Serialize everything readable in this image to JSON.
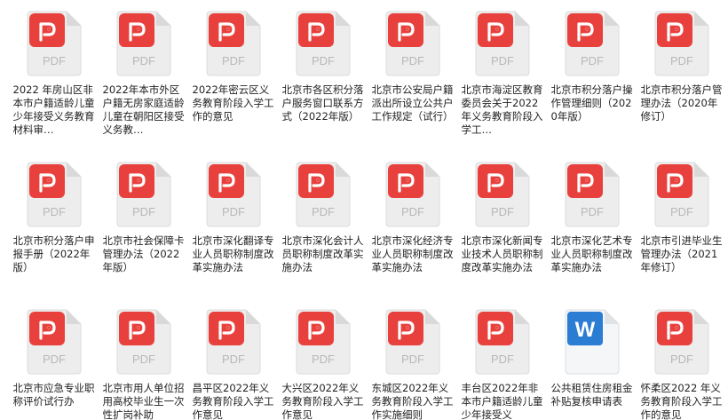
{
  "colors": {
    "pdf_badge": "#E8413D",
    "word_badge": "#2B7CD3",
    "page_bg": "#EDEDED",
    "label_text": "#222222"
  },
  "files": [
    {
      "name": "2022 年房山区非本市户籍适龄儿童少年接受义务教育材料审…",
      "type": "pdf",
      "icon": "pdf-icon",
      "badge": "PDF"
    },
    {
      "name": "2022年本市外区户籍无房家庭适龄儿童在朝阳区接受义务教…",
      "type": "pdf",
      "icon": "pdf-icon",
      "badge": "PDF"
    },
    {
      "name": "2022年密云区义务教育阶段入学工作的意见",
      "type": "pdf",
      "icon": "pdf-icon",
      "badge": "PDF"
    },
    {
      "name": "北京市各区积分落户服务窗口联系方式（2022年版）",
      "type": "pdf",
      "icon": "pdf-icon",
      "badge": "PDF"
    },
    {
      "name": "北京市公安局户籍派出所设立公共户工作规定（试行）",
      "type": "pdf",
      "icon": "pdf-icon",
      "badge": "PDF"
    },
    {
      "name": "北京市海淀区教育委员会关于2022年义务教育阶段入学工…",
      "type": "pdf",
      "icon": "pdf-icon",
      "badge": "PDF"
    },
    {
      "name": "北京市积分落户操作管理细则（2020年版）",
      "type": "pdf",
      "icon": "pdf-icon",
      "badge": "PDF"
    },
    {
      "name": "北京市积分落户管理办法（2020年修订）",
      "type": "pdf",
      "icon": "pdf-icon",
      "badge": "PDF"
    },
    {
      "name": "北京市积分落户申报手册（2022年版）",
      "type": "pdf",
      "icon": "pdf-icon",
      "badge": "PDF"
    },
    {
      "name": "北京市社会保障卡管理办法（2022年版）",
      "type": "pdf",
      "icon": "pdf-icon",
      "badge": "PDF"
    },
    {
      "name": "北京市深化翻译专业人员职称制度改革实施办法",
      "type": "pdf",
      "icon": "pdf-icon",
      "badge": "PDF"
    },
    {
      "name": "北京市深化会计人员职称制度改革实施办法",
      "type": "pdf",
      "icon": "pdf-icon",
      "badge": "PDF"
    },
    {
      "name": "北京市深化经济专业人员职称制度改革实施办法",
      "type": "pdf",
      "icon": "pdf-icon",
      "badge": "PDF"
    },
    {
      "name": "北京市深化新闻专业技术人员职称制度改革实施办法",
      "type": "pdf",
      "icon": "pdf-icon",
      "badge": "PDF"
    },
    {
      "name": "北京市深化艺术专业人员职称制度改革实施办法",
      "type": "pdf",
      "icon": "pdf-icon",
      "badge": "PDF"
    },
    {
      "name": "北京市引进毕业生管理办法（2021年修订）",
      "type": "pdf",
      "icon": "pdf-icon",
      "badge": "PDF"
    },
    {
      "name": "北京市应急专业职称评价试行办",
      "type": "pdf",
      "icon": "pdf-icon",
      "badge": "PDF"
    },
    {
      "name": "北京市用人单位招用高校毕业生一次性扩岗补助",
      "type": "pdf",
      "icon": "pdf-icon",
      "badge": "PDF"
    },
    {
      "name": "昌平区2022年义务教育阶段入学工作意见",
      "type": "pdf",
      "icon": "pdf-icon",
      "badge": "PDF"
    },
    {
      "name": "大兴区2022年义务教育阶段入学工作意见",
      "type": "pdf",
      "icon": "pdf-icon",
      "badge": "PDF"
    },
    {
      "name": "东城区2022年义务教育阶段入学工作实施细则",
      "type": "pdf",
      "icon": "pdf-icon",
      "badge": "PDF"
    },
    {
      "name": "丰台区2022年非本市户籍适龄儿童少年接受义",
      "type": "pdf",
      "icon": "pdf-icon",
      "badge": "PDF"
    },
    {
      "name": "公共租赁住房租金补贴复核申请表",
      "type": "word",
      "icon": "word-icon",
      "badge": "W"
    },
    {
      "name": "怀柔区2022 年义务教育阶段入学工作的意见",
      "type": "pdf",
      "icon": "pdf-icon",
      "badge": "PDF"
    }
  ]
}
